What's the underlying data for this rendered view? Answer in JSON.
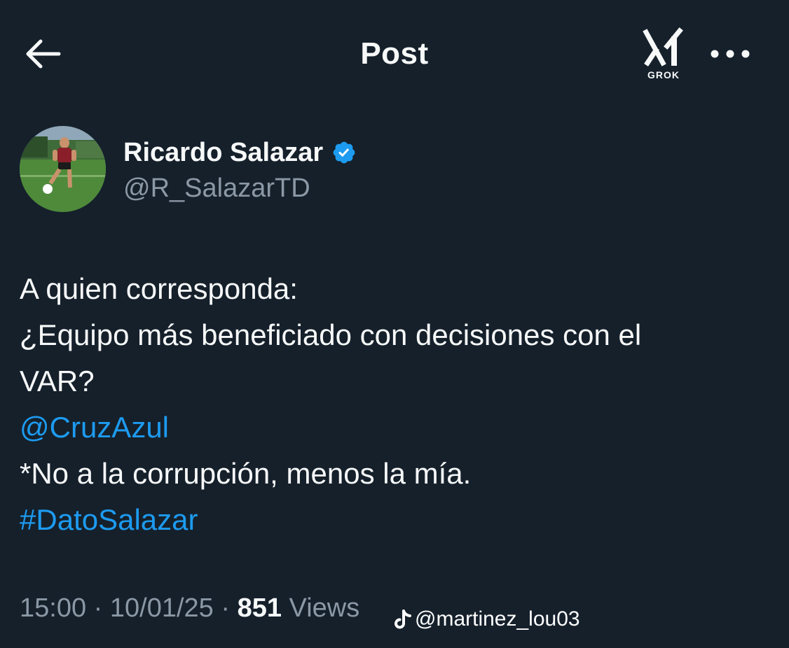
{
  "header": {
    "title": "Post",
    "grok_label": "GROK",
    "icons": {
      "back": "arrow-left-icon",
      "grok": "grok-logo-icon",
      "more": "more-horizontal-icon"
    }
  },
  "author": {
    "display_name": "Ricardo Salazar",
    "handle": "@R_SalazarTD",
    "verified": true,
    "verified_color": "#1d9bf0",
    "avatar_icon": "avatar-photo"
  },
  "tweet": {
    "lines": [
      {
        "text": "A quien corresponda:",
        "type": "text"
      },
      {
        "text": "¿Equipo más beneficiado con decisiones con el",
        "type": "text"
      },
      {
        "text": "VAR?",
        "type": "text"
      },
      {
        "text": "@CruzAzul",
        "type": "mention"
      },
      {
        "text": "*No a la corrupción, menos la mía.",
        "type": "text"
      },
      {
        "text": "#DatoSalazar",
        "type": "hashtag"
      }
    ]
  },
  "meta": {
    "time": "15:00",
    "date": "10/01/25",
    "separator": "·",
    "views_count": "851",
    "views_label": "Views"
  },
  "watermark": {
    "icon": "tiktok-icon",
    "handle": "@martinez_lou03"
  },
  "colors": {
    "background": "#15202b",
    "text": "#f7f9f9",
    "secondary": "#8b98a5",
    "accent": "#1d9bf0"
  }
}
